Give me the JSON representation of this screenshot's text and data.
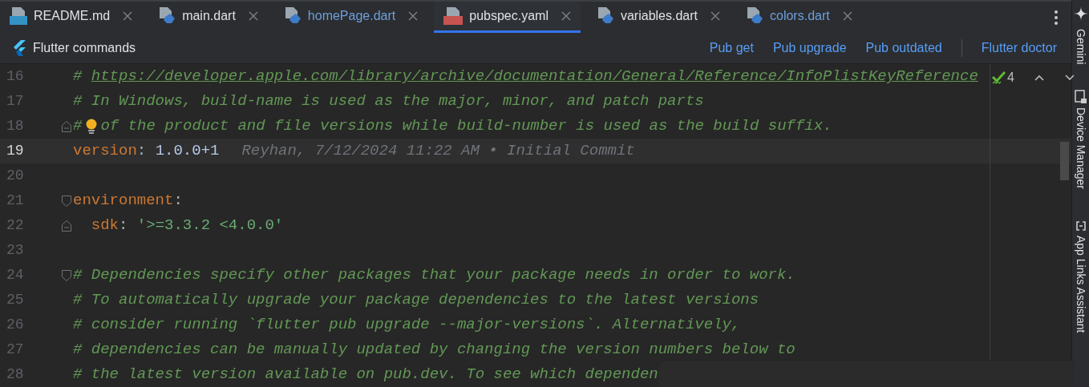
{
  "tabs": [
    {
      "label": "README.md",
      "kind": "markdown",
      "selected": false,
      "modified": false
    },
    {
      "label": "main.dart",
      "kind": "dart",
      "selected": false,
      "modified": false
    },
    {
      "label": "homePage.dart",
      "kind": "dart",
      "selected": false,
      "modified": true
    },
    {
      "label": "pubspec.yaml",
      "kind": "yaml",
      "selected": true,
      "modified": false
    },
    {
      "label": "variables.dart",
      "kind": "dart",
      "selected": false,
      "modified": false
    },
    {
      "label": "colors.dart",
      "kind": "dart",
      "selected": false,
      "modified": true
    }
  ],
  "toolbar": {
    "title": "Flutter commands",
    "actions": [
      "Pub get",
      "Pub upgrade",
      "Pub outdated"
    ],
    "extra_action": "Flutter doctor"
  },
  "inspection": {
    "count": "4"
  },
  "lines": [
    {
      "number": "16",
      "current": false,
      "fold_start": false,
      "fold_end": false,
      "bulb": false,
      "tokens": [
        {
          "kind": "comment",
          "text": "# "
        },
        {
          "kind": "link",
          "text": "https://developer.apple.com/library/archive/documentation/General/Reference/InfoPlistKeyReference"
        }
      ]
    },
    {
      "number": "17",
      "current": false,
      "fold_start": false,
      "fold_end": false,
      "bulb": false,
      "tokens": [
        {
          "kind": "comment",
          "text": "# In Windows, build-name is used as the major, minor, and patch parts"
        }
      ]
    },
    {
      "number": "18",
      "current": false,
      "fold_start": false,
      "fold_end": true,
      "bulb": true,
      "tokens": [
        {
          "kind": "comment",
          "text": "#"
        },
        {
          "kind": "comment",
          "text": "of the product and file versions while build-number is used as the build suffix."
        }
      ]
    },
    {
      "number": "19",
      "current": true,
      "fold_start": false,
      "fold_end": false,
      "bulb": false,
      "tokens": [
        {
          "kind": "key",
          "text": "version"
        },
        {
          "kind": "plain",
          "text": ": "
        },
        {
          "kind": "value",
          "text": "1.0.0+1"
        },
        {
          "kind": "blame",
          "text": "Reyhan, 7/12/2024 11:22 AM • Initial Commit"
        }
      ]
    },
    {
      "number": "20",
      "current": false,
      "fold_start": false,
      "fold_end": false,
      "bulb": false
    },
    {
      "number": "21",
      "current": false,
      "fold_start": true,
      "fold_end": false,
      "bulb": false,
      "tokens": [
        {
          "kind": "key",
          "text": "environment"
        },
        {
          "kind": "plain",
          "text": ":"
        }
      ]
    },
    {
      "number": "22",
      "current": false,
      "fold_start": false,
      "fold_end": true,
      "bulb": false,
      "tokens": [
        {
          "kind": "key",
          "text": "  sdk"
        },
        {
          "kind": "plain",
          "text": ": "
        },
        {
          "kind": "string",
          "text": "'>=3.3.2 <4.0.0'"
        }
      ]
    },
    {
      "number": "23",
      "current": false,
      "fold_start": false,
      "fold_end": false,
      "bulb": false
    },
    {
      "number": "24",
      "current": false,
      "fold_start": true,
      "fold_end": false,
      "bulb": false,
      "tokens": [
        {
          "kind": "comment",
          "text": "# Dependencies specify other packages that your package needs in order to work."
        }
      ]
    },
    {
      "number": "25",
      "current": false,
      "fold_start": false,
      "fold_end": false,
      "bulb": false,
      "tokens": [
        {
          "kind": "comment",
          "text": "# To automatically upgrade your package dependencies to the latest versions"
        }
      ]
    },
    {
      "number": "26",
      "current": false,
      "fold_start": false,
      "fold_end": false,
      "bulb": false,
      "tokens": [
        {
          "kind": "comment",
          "text": "# consider running `flutter pub upgrade --major-versions`. Alternatively,"
        }
      ]
    },
    {
      "number": "27",
      "current": false,
      "fold_start": false,
      "fold_end": false,
      "bulb": false,
      "tokens": [
        {
          "kind": "comment",
          "text": "# dependencies can be manually updated by changing the version numbers below to"
        }
      ]
    },
    {
      "number": "28",
      "current": false,
      "fold_start": false,
      "fold_end": false,
      "bulb": false,
      "tokens": [
        {
          "kind": "comment",
          "text": "# the latest version available on pub.dev. To see which dependen"
        }
      ]
    }
  ],
  "side_tools": [
    "Gemini",
    "Device Manager",
    "App Links Assistant"
  ]
}
